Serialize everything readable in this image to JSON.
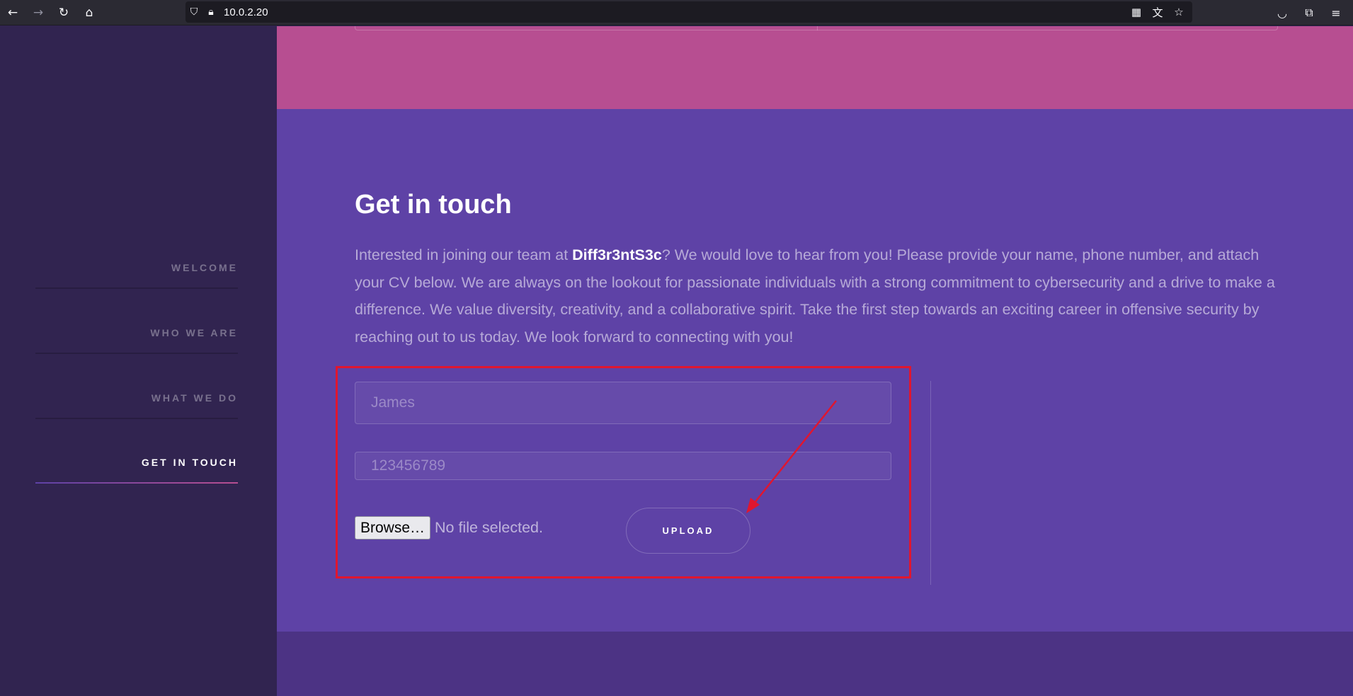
{
  "browser": {
    "url": "10.0.2.20",
    "icons": {
      "back": "back-arrow-icon",
      "forward": "forward-arrow-icon",
      "reload": "reload-icon",
      "home": "home-icon",
      "shield": "shield-icon",
      "lock": "lock-icon",
      "qr": "qr-code-icon",
      "translate": "translate-icon",
      "bookmark": "star-icon",
      "pocket": "pocket-icon",
      "extensions": "extensions-icon",
      "menu": "hamburger-menu-icon"
    }
  },
  "sidebar": {
    "items": [
      {
        "label": "WELCOME",
        "active": false
      },
      {
        "label": "WHO WE ARE",
        "active": false
      },
      {
        "label": "WHAT WE DO",
        "active": false
      },
      {
        "label": "GET IN TOUCH",
        "active": true
      }
    ]
  },
  "contact": {
    "heading": "Get in touch",
    "intro_before": "Interested in joining our team at ",
    "intro_brand": "Diff3r3ntS3c",
    "intro_after": "? We would love to hear from you! Please provide your name, phone number, and attach your CV below. We are always on the lookout for passionate individuals with a strong commitment to cybersecurity and a drive to make a difference. We value diversity, creativity, and a collaborative spirit. Take the first step towards an exciting career in offensive security by reaching out to us today. We look forward to connecting with you!",
    "name_placeholder": "James",
    "phone_placeholder": "123456789",
    "browse_label": "Browse…",
    "file_status": "No file selected.",
    "upload_label": "UPLOAD"
  },
  "colors": {
    "sidebar": "#312450",
    "section": "#5e42a6",
    "accent_pink": "#b74e91",
    "annotation_red": "#e0162f"
  }
}
